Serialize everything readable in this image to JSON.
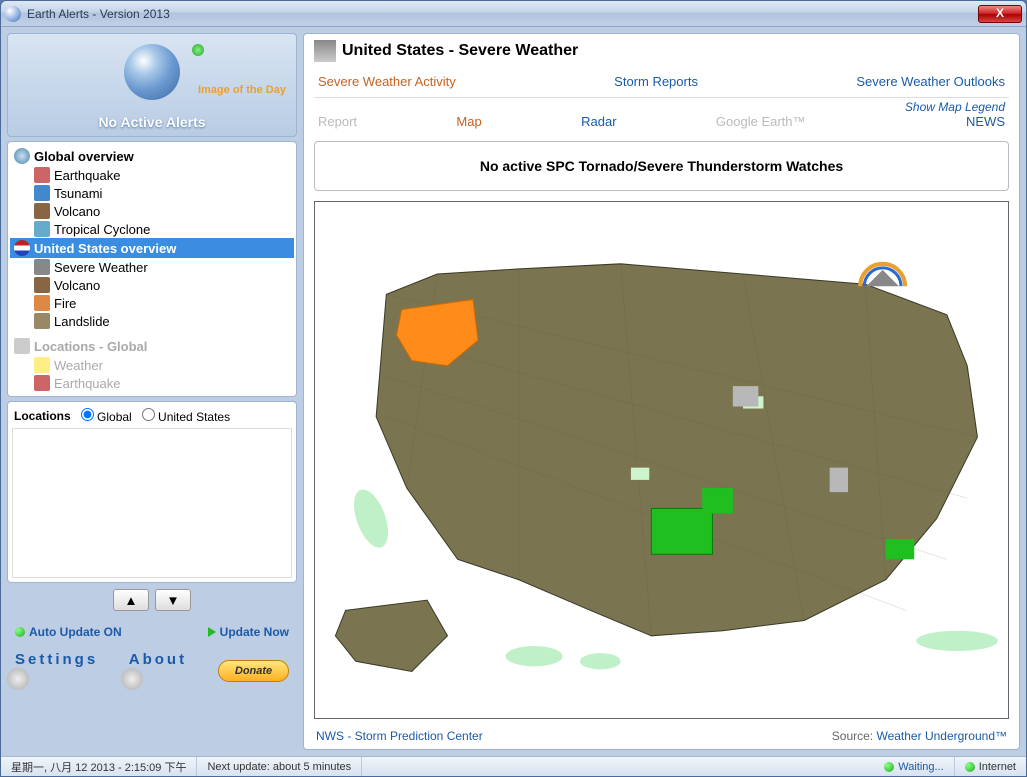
{
  "window": {
    "title": "Earth Alerts - Version 2013"
  },
  "sidebar": {
    "image_of_day": "Image of the Day",
    "no_alerts": "No Active Alerts",
    "global": {
      "header": "Global overview",
      "items": [
        "Earthquake",
        "Tsunami",
        "Volcano",
        "Tropical Cyclone"
      ]
    },
    "us": {
      "header": "United States overview",
      "items": [
        "Severe Weather",
        "Volcano",
        "Fire",
        "Landslide"
      ]
    },
    "locs_global": {
      "header": "Locations - Global",
      "items": [
        "Weather",
        "Earthquake"
      ]
    },
    "locations_label": "Locations",
    "radio_global": "Global",
    "radio_us": "United States",
    "auto_update": "Auto Update ON",
    "update_now": "Update Now",
    "settings": "Settings",
    "about": "About",
    "donate": "Donate"
  },
  "main": {
    "title": "United States - Severe Weather",
    "tabs1": {
      "a": "Severe Weather Activity",
      "b": "Storm Reports",
      "c": "Severe Weather Outlooks"
    },
    "tabs2": {
      "report": "Report",
      "map": "Map",
      "radar": "Radar",
      "gearth": "Google Earth™",
      "legend": "Show Map Legend",
      "news": "NEWS"
    },
    "alert_text": "No active SPC Tornado/Severe Thunderstorm Watches",
    "footer": {
      "left": "NWS - Storm Prediction Center",
      "src_label": "Source: ",
      "src_link": "Weather Underground™"
    }
  },
  "status": {
    "datetime": "星期一, 八月 12 2013 - 2:15:09 下午",
    "next": "Next update: about 5 minutes",
    "waiting": "Waiting...",
    "internet": "Internet"
  }
}
